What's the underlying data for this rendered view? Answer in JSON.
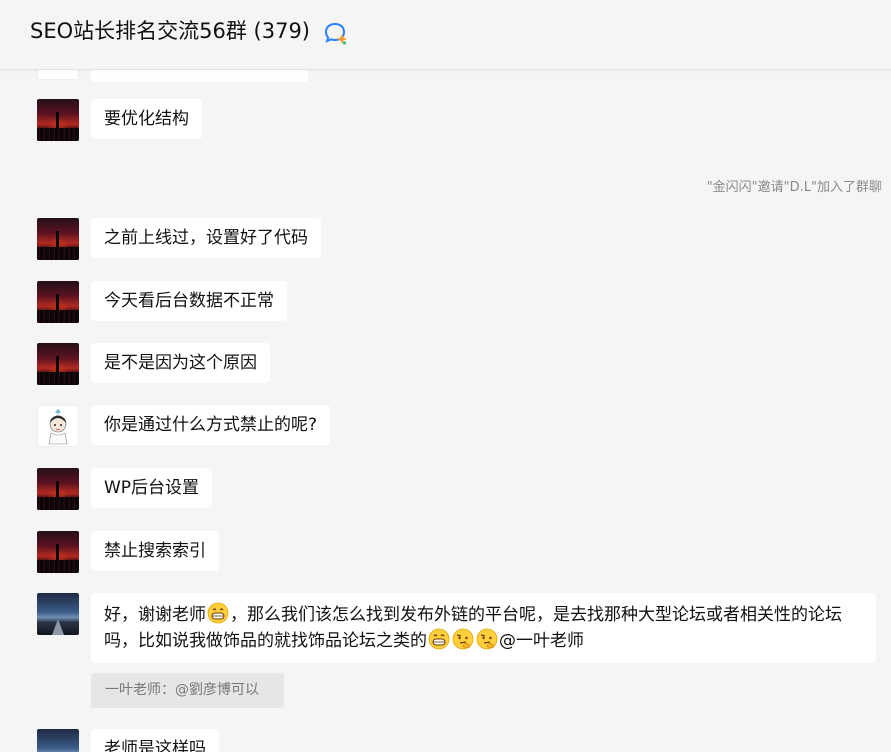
{
  "header": {
    "title": "SEO站长排名交流56群 (379)",
    "icon": "group-chat-icon"
  },
  "notice": {
    "system": "\"金闪闪\"邀请\"D.L\"加入了群聊"
  },
  "messages": [
    {
      "avatar": "avatar-sunset",
      "text": ""
    },
    {
      "avatar": "avatar-sunset",
      "text": "要优化结构"
    },
    {
      "avatar": "avatar-sunset",
      "text": "之前上线过，设置好了代码"
    },
    {
      "avatar": "avatar-sunset",
      "text": "今天看后台数据不正常"
    },
    {
      "avatar": "avatar-sunset",
      "text": "是不是因为这个原因"
    },
    {
      "avatar": "avatar-girl",
      "text": "你是通过什么方式禁止的呢?"
    },
    {
      "avatar": "avatar-sunset",
      "text": "WP后台设置"
    },
    {
      "avatar": "avatar-sunset",
      "text": "禁止搜索索引"
    },
    {
      "avatar": "avatar-road",
      "parts": [
        "好，谢谢老师",
        "，那么我们该怎么找到发布外链的平台呢，是去找那种大型论坛或者相关性的论坛吗，比如说我做饰品的就找饰品论坛之类的",
        "@一叶老师"
      ],
      "emojis": [
        "grin-emoji",
        "grin-emoji",
        "thinking-emoji",
        "thinking-emoji"
      ]
    },
    {
      "avatar": "avatar-road",
      "text": "老师是这样吗"
    }
  ],
  "quote": {
    "text": "一叶老师：@劉彦博可以"
  },
  "colors": {
    "background": "#f5f5f5",
    "bubble": "#ffffff",
    "quote_background": "#e6e6e6",
    "icon_blue": "#2a7fff"
  }
}
